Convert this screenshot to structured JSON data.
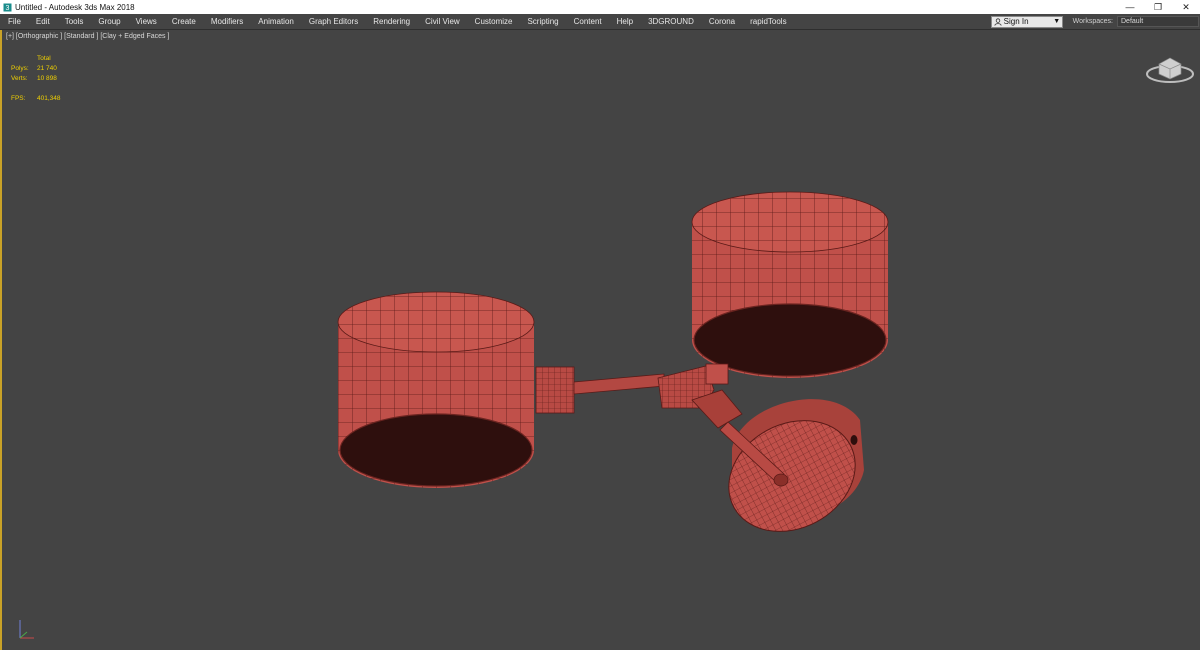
{
  "titlebar": {
    "title": "Untitled - Autodesk 3ds Max 2018",
    "minimize_glyph": "—",
    "restore_glyph": "❐",
    "close_glyph": "✕"
  },
  "menu": {
    "items": [
      "File",
      "Edit",
      "Tools",
      "Group",
      "Views",
      "Create",
      "Modifiers",
      "Animation",
      "Graph Editors",
      "Rendering",
      "Civil View",
      "Customize",
      "Scripting",
      "Content",
      "Help",
      "3DGROUND",
      "Corona",
      "rapidTools"
    ],
    "sign_in_label": "Sign In",
    "workspaces_label": "Workspaces:",
    "workspace_value": "Default"
  },
  "viewport": {
    "label": "[+] [Orthographic ] [Standard ] [Clay + Edged Faces ]",
    "stats": {
      "header": "Total",
      "polys_label": "Polys:",
      "polys_value": "21 740",
      "verts_label": "Verts:",
      "verts_value": "10 898",
      "fps_label": "FPS:",
      "fps_value": "401,348"
    }
  },
  "colors": {
    "viewport_bg": "#444444",
    "active_border": "#c9a227",
    "stats_text": "#f0d000",
    "model_fill": "#c0504a",
    "model_edge": "#5a1a17",
    "model_inner": "#2e0f0d"
  },
  "icons": [
    "app-icon",
    "user-icon",
    "dropdown-arrow-icon",
    "viewcube-icon",
    "axis-tripod-icon"
  ]
}
